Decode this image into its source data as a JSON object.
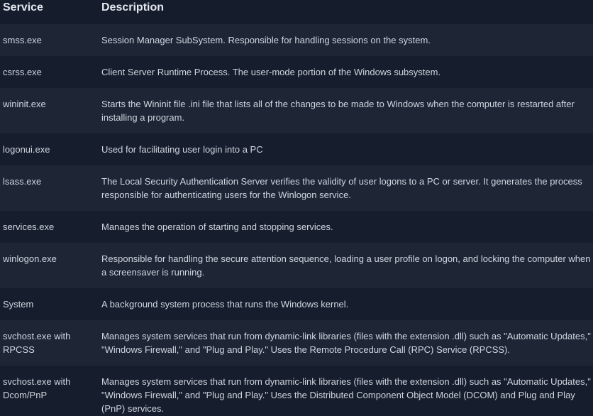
{
  "table": {
    "headers": [
      "Service",
      "Description"
    ],
    "rows": [
      {
        "service": "smss.exe",
        "description": "Session Manager SubSystem. Responsible for handling sessions on the system."
      },
      {
        "service": "csrss.exe",
        "description": "Client Server Runtime Process. The user-mode portion of the Windows subsystem."
      },
      {
        "service": "wininit.exe",
        "description": "Starts the Wininit file .ini file that lists all of the changes to be made to Windows when the computer is restarted after installing a program."
      },
      {
        "service": "logonui.exe",
        "description": "Used for facilitating user login into a PC"
      },
      {
        "service": "lsass.exe",
        "description": "The Local Security Authentication Server verifies the validity of user logons to a PC or server. It generates the process responsible for authenticating users for the Winlogon service."
      },
      {
        "service": "services.exe",
        "description": "Manages the operation of starting and stopping services."
      },
      {
        "service": "winlogon.exe",
        "description": "Responsible for handling the secure attention sequence, loading a user profile on logon, and locking the computer when a screensaver is running."
      },
      {
        "service": "System",
        "description": "A background system process that runs the Windows kernel."
      },
      {
        "service": "svchost.exe with RPCSS",
        "description": "Manages system services that run from dynamic-link libraries (files with the extension .dll) such as \"Automatic Updates,\" \"Windows Firewall,\" and \"Plug and Play.\" Uses the Remote Procedure Call (RPC) Service (RPCSS)."
      },
      {
        "service": "svchost.exe with Dcom/PnP",
        "description": "Manages system services that run from dynamic-link libraries (files with the extension .dll) such as \"Automatic Updates,\" \"Windows Firewall,\" and \"Plug and Play.\" Uses the Distributed Component Object Model (DCOM) and Plug and Play (PnP) services."
      }
    ]
  }
}
